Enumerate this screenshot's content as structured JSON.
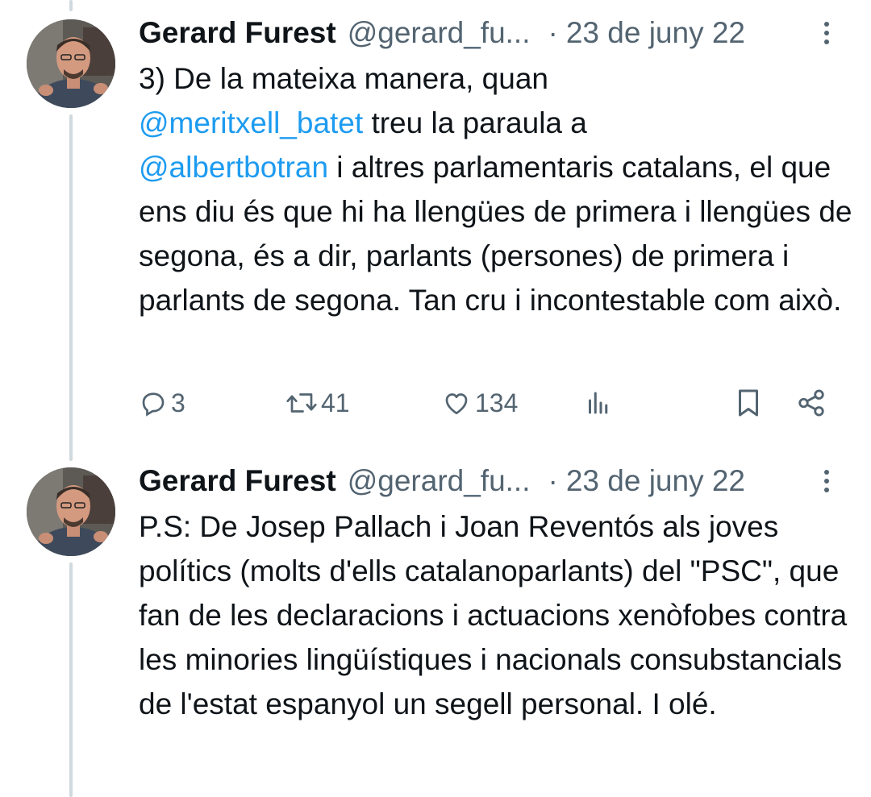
{
  "tweets": [
    {
      "author": "Gerard Furest",
      "handle": "@gerard_fu...",
      "separator": "·",
      "date": "23 de juny 22",
      "text": {
        "p1": "3) De la mateixa manera, quan",
        "mention1": "@meritxell_batet",
        "p2": " treu la paraula a",
        "mention2": "@albertbotran",
        "p3": " i altres parlamentaris catalans, el que ens diu és que hi ha llengües de primera i llengües de segona, és a dir, parlants (persones) de primera i parlants de segona. Tan cru i incontestable com això."
      },
      "replies": "3",
      "retweets": "41",
      "likes": "134"
    },
    {
      "author": "Gerard Furest",
      "handle": "@gerard_fu...",
      "separator": "·",
      "date": "23 de juny 22",
      "text": "P.S: De Josep Pallach i Joan Reventós als joves polítics (molts d'ells catalanoparlants) del \"PSC\", que fan de les declaracions i actuacions xenòfobes contra les minories lingüístiques i nacionals consubstancials de l'estat espanyol un segell personal. I olé."
    }
  ],
  "colors": {
    "text": "#0f1419",
    "secondary": "#536471",
    "link": "#1d9bf0",
    "thread": "#cfd9de"
  },
  "icons": [
    "more-icon",
    "reply-icon",
    "retweet-icon",
    "like-icon",
    "views-icon",
    "bookmark-icon",
    "share-icon"
  ]
}
